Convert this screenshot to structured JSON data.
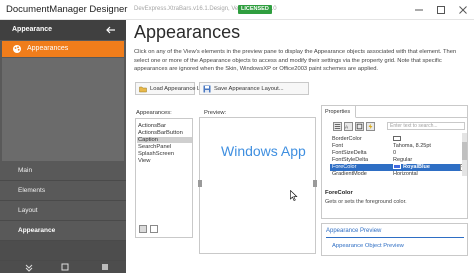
{
  "window": {
    "title": "DocumentManager Designer",
    "subtitle": "DevExpress.XtraBars.v16.1.Design, Version=16.1.5.0",
    "license_badge": "LICENSED"
  },
  "left_panel": {
    "header_label": "Appearance",
    "active_item": "Appearances",
    "sections": [
      "Main",
      "Elements",
      "Layout",
      "Appearance"
    ]
  },
  "main": {
    "title": "Appearances",
    "description": "Click on any of the View's elements in the preview pane to display the Appearance objects associated with that element. Then select one or more of the Appearance objects to access and modify their settings via the property grid. Note that specific appearances are ignored when the Skin, WindowsXP or Office2003 paint schemes are applied.",
    "load_button": "Load Appearance Layout...",
    "save_button": "Save Appearance Layout...",
    "appearances_label": "Appearances:",
    "preview_label": "Preview:",
    "appearances_list": [
      "ActionsBar",
      "ActionsBarButton",
      "Caption",
      "SearchPanel",
      "SplashScreen",
      "View"
    ],
    "selected_appearance": "Caption",
    "preview_text": "Windows App"
  },
  "properties": {
    "tab_label": "Properties",
    "search_placeholder": "Enter text to search...",
    "rows": [
      {
        "name": "BorderColor",
        "value": ""
      },
      {
        "name": "Font",
        "value": "Tahoma, 8.25pt"
      },
      {
        "name": "FontSizeDelta",
        "value": "0"
      },
      {
        "name": "FontStyleDelta",
        "value": "Regular"
      },
      {
        "name": "ForeColor",
        "value": "RoyalBlue"
      },
      {
        "name": "GradientMode",
        "value": "Horizontal"
      }
    ],
    "selected_property": "ForeColor",
    "desc_title": "ForeColor",
    "desc_text": "Gets or sets the foreground color."
  },
  "appearance_preview": {
    "title": "Appearance Preview",
    "link": "Appearance Object Preview"
  },
  "colors": {
    "accent": "#f07d1b",
    "preview_text": "#3f8fe0",
    "selection": "#2e6ec4",
    "royal_blue": "#4169e1",
    "license_green": "#2f9e3f"
  }
}
